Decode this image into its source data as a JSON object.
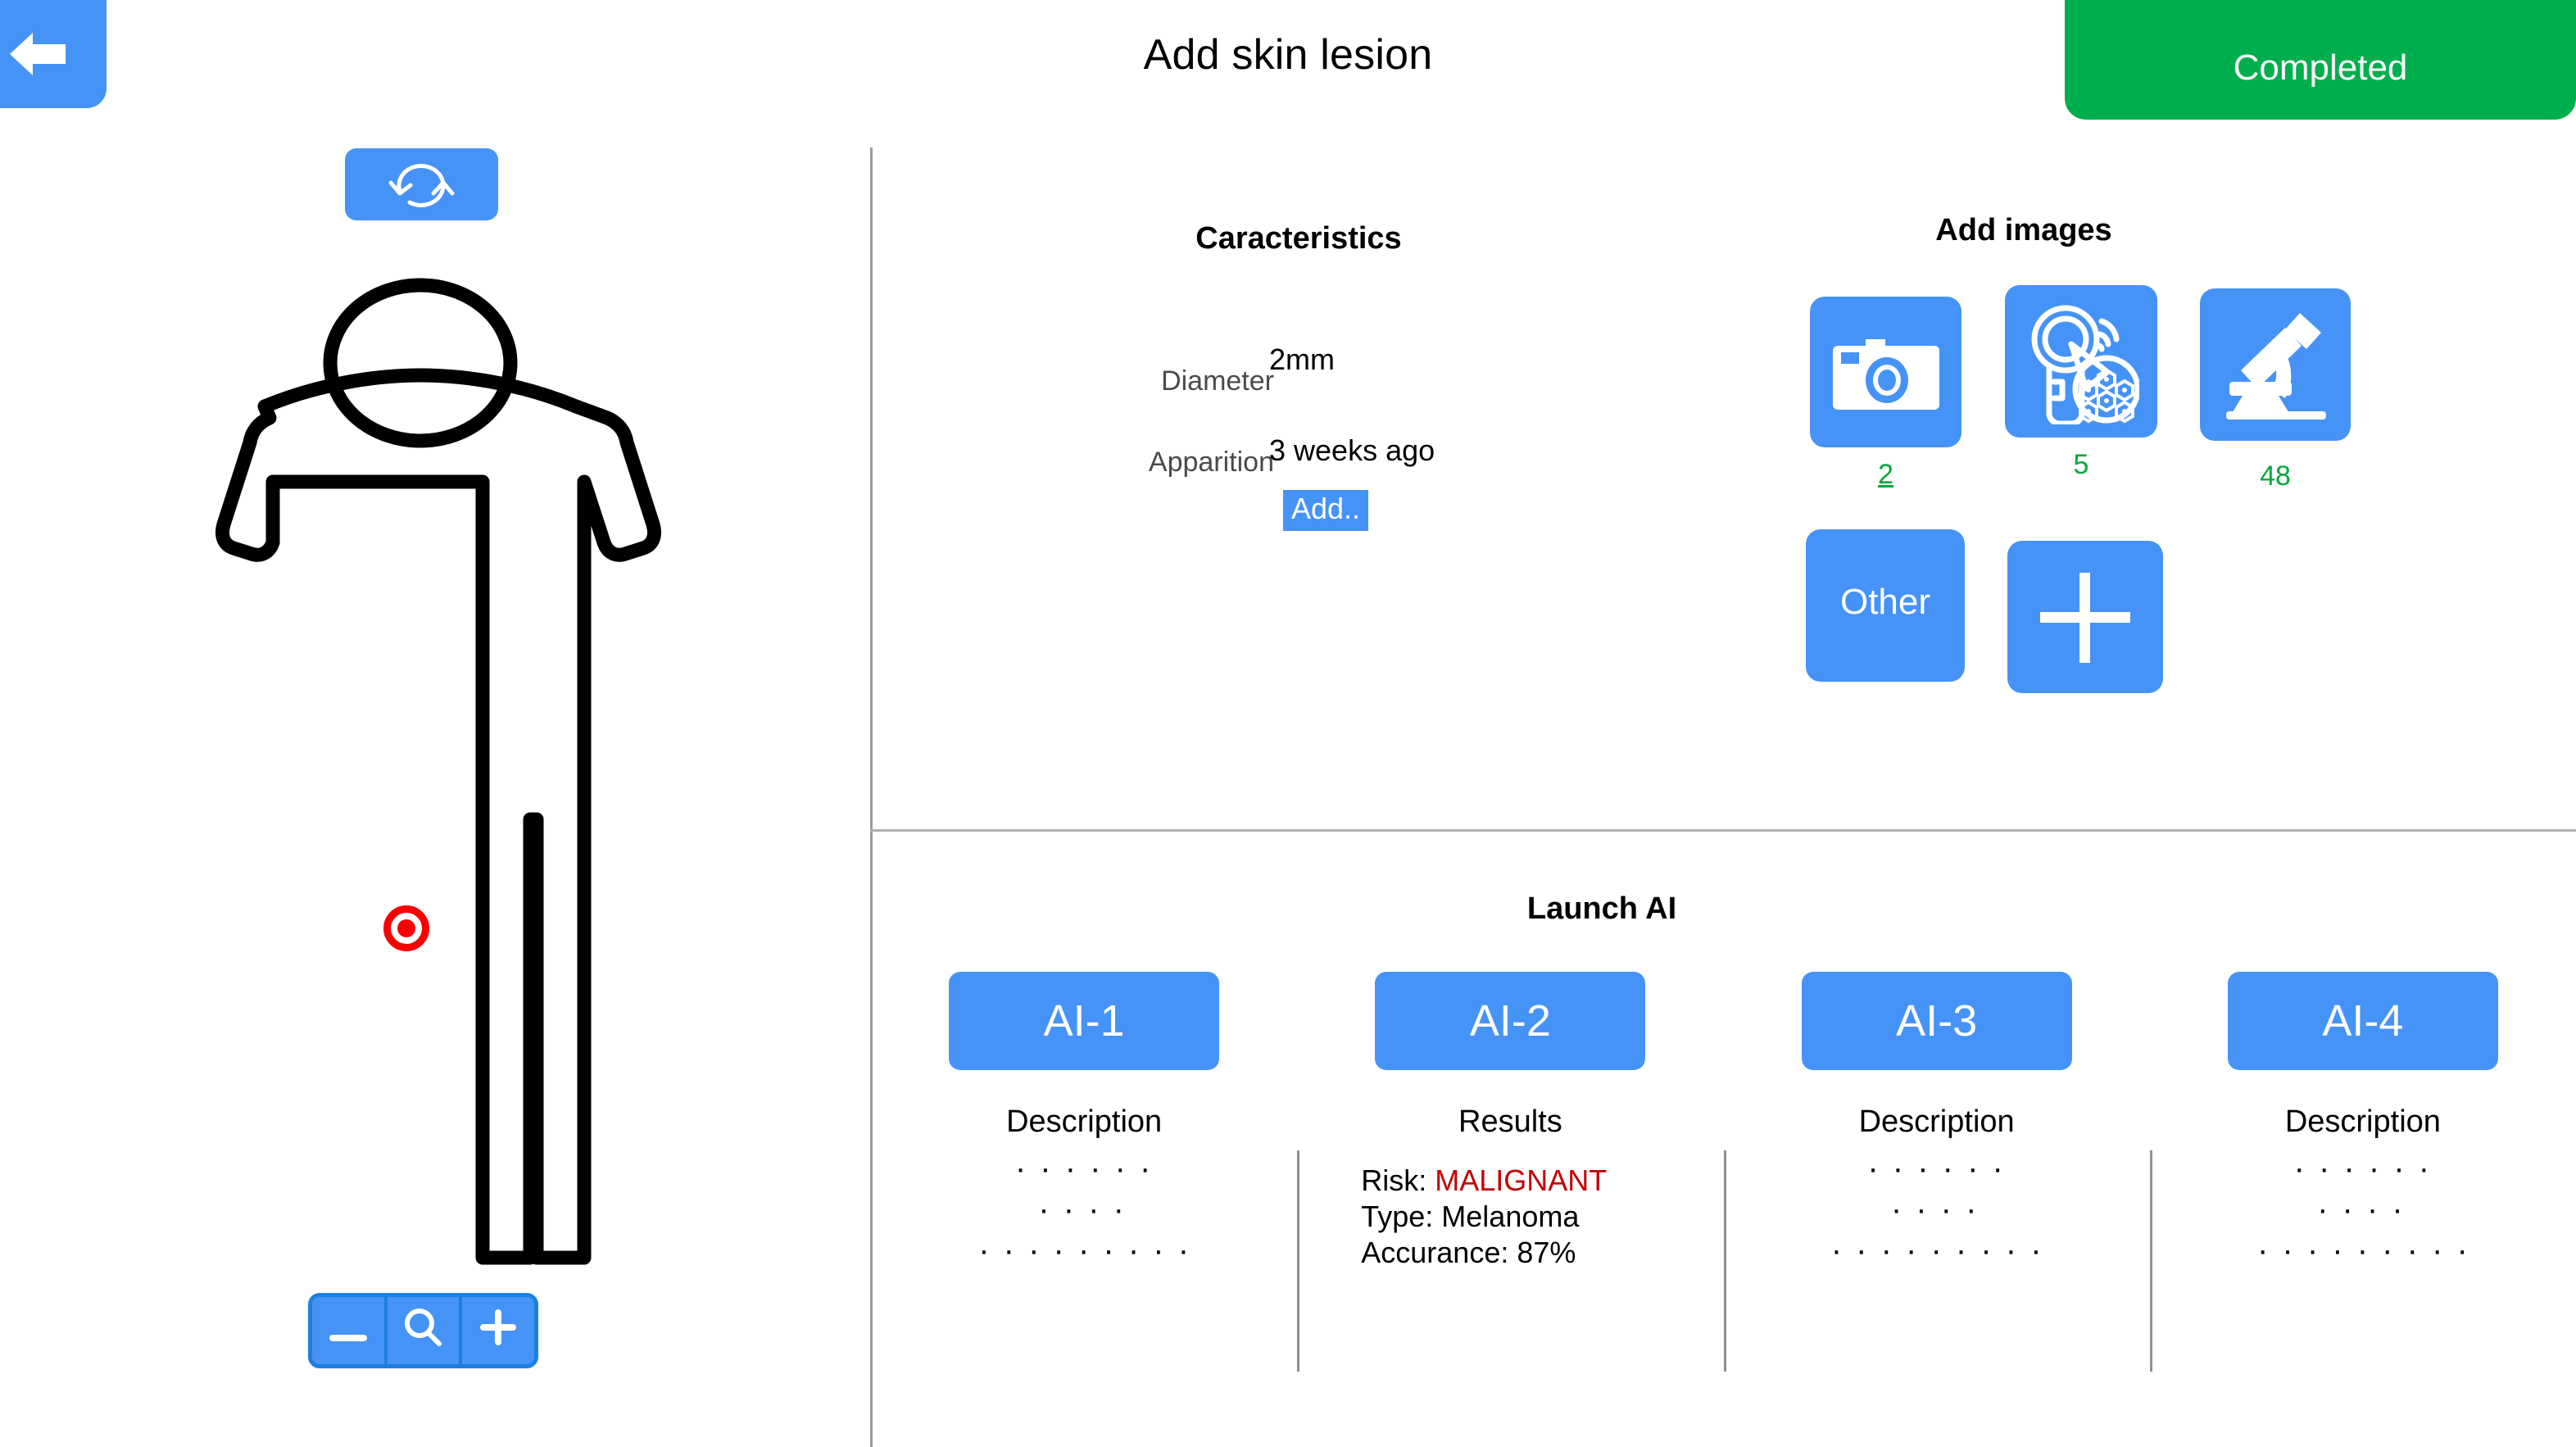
{
  "header": {
    "title": "Add skin lesion",
    "back_icon": "arrow-left-icon",
    "completed_label": "Completed",
    "completed_color": "#00AE4D"
  },
  "body_panel": {
    "rotate_icon": "rotate-refresh-icon",
    "lesion_marker": "lesion-marker-red",
    "zoom_controls": [
      {
        "name": "zoom-out",
        "glyph": "—"
      },
      {
        "name": "zoom-reset",
        "glyph": "search-icon"
      },
      {
        "name": "zoom-in",
        "glyph": "+"
      }
    ]
  },
  "caracteristics": {
    "heading": "Caracteristics",
    "rows": [
      {
        "label": "Diameter",
        "value": "2mm"
      },
      {
        "label": "Apparition",
        "value": "3 weeks ago"
      }
    ],
    "add_label": "Add.."
  },
  "add_images": {
    "heading": "Add images",
    "buttons": [
      {
        "icon": "camera-icon",
        "count": "2"
      },
      {
        "icon": "dermatoscope-icon",
        "count": "5"
      },
      {
        "icon": "microscope-icon",
        "count": "48"
      }
    ],
    "other_label": "Other",
    "plus_icon": "plus-icon",
    "count_color": "#00A83C"
  },
  "launch_ai": {
    "heading": "Launch AI",
    "columns": [
      {
        "button": "AI-1",
        "sub": "Description",
        "dots": [
          "· · · · · ·",
          "· · · ·",
          "· · · · · · · · ·"
        ]
      },
      {
        "button": "AI-2",
        "sub": "Results",
        "results": {
          "risk_label": "Risk: ",
          "risk_value": "MALIGNANT",
          "type_line": "Type: Melanoma",
          "accuracy_line": "Accurance: 87%"
        }
      },
      {
        "button": "AI-3",
        "sub": "Description",
        "dots": [
          "· · · · · ·",
          "· · · ·",
          "· · · · · · · · ·"
        ]
      },
      {
        "button": "AI-4",
        "sub": "Description",
        "dots": [
          "· · · · · ·",
          "· · · ·",
          "· · · · · · · · ·"
        ]
      }
    ]
  },
  "colors": {
    "accent_blue": "#4693F7",
    "green": "#00AE4D",
    "risk_red": "#C20000",
    "marker_red": "#FC0000"
  }
}
